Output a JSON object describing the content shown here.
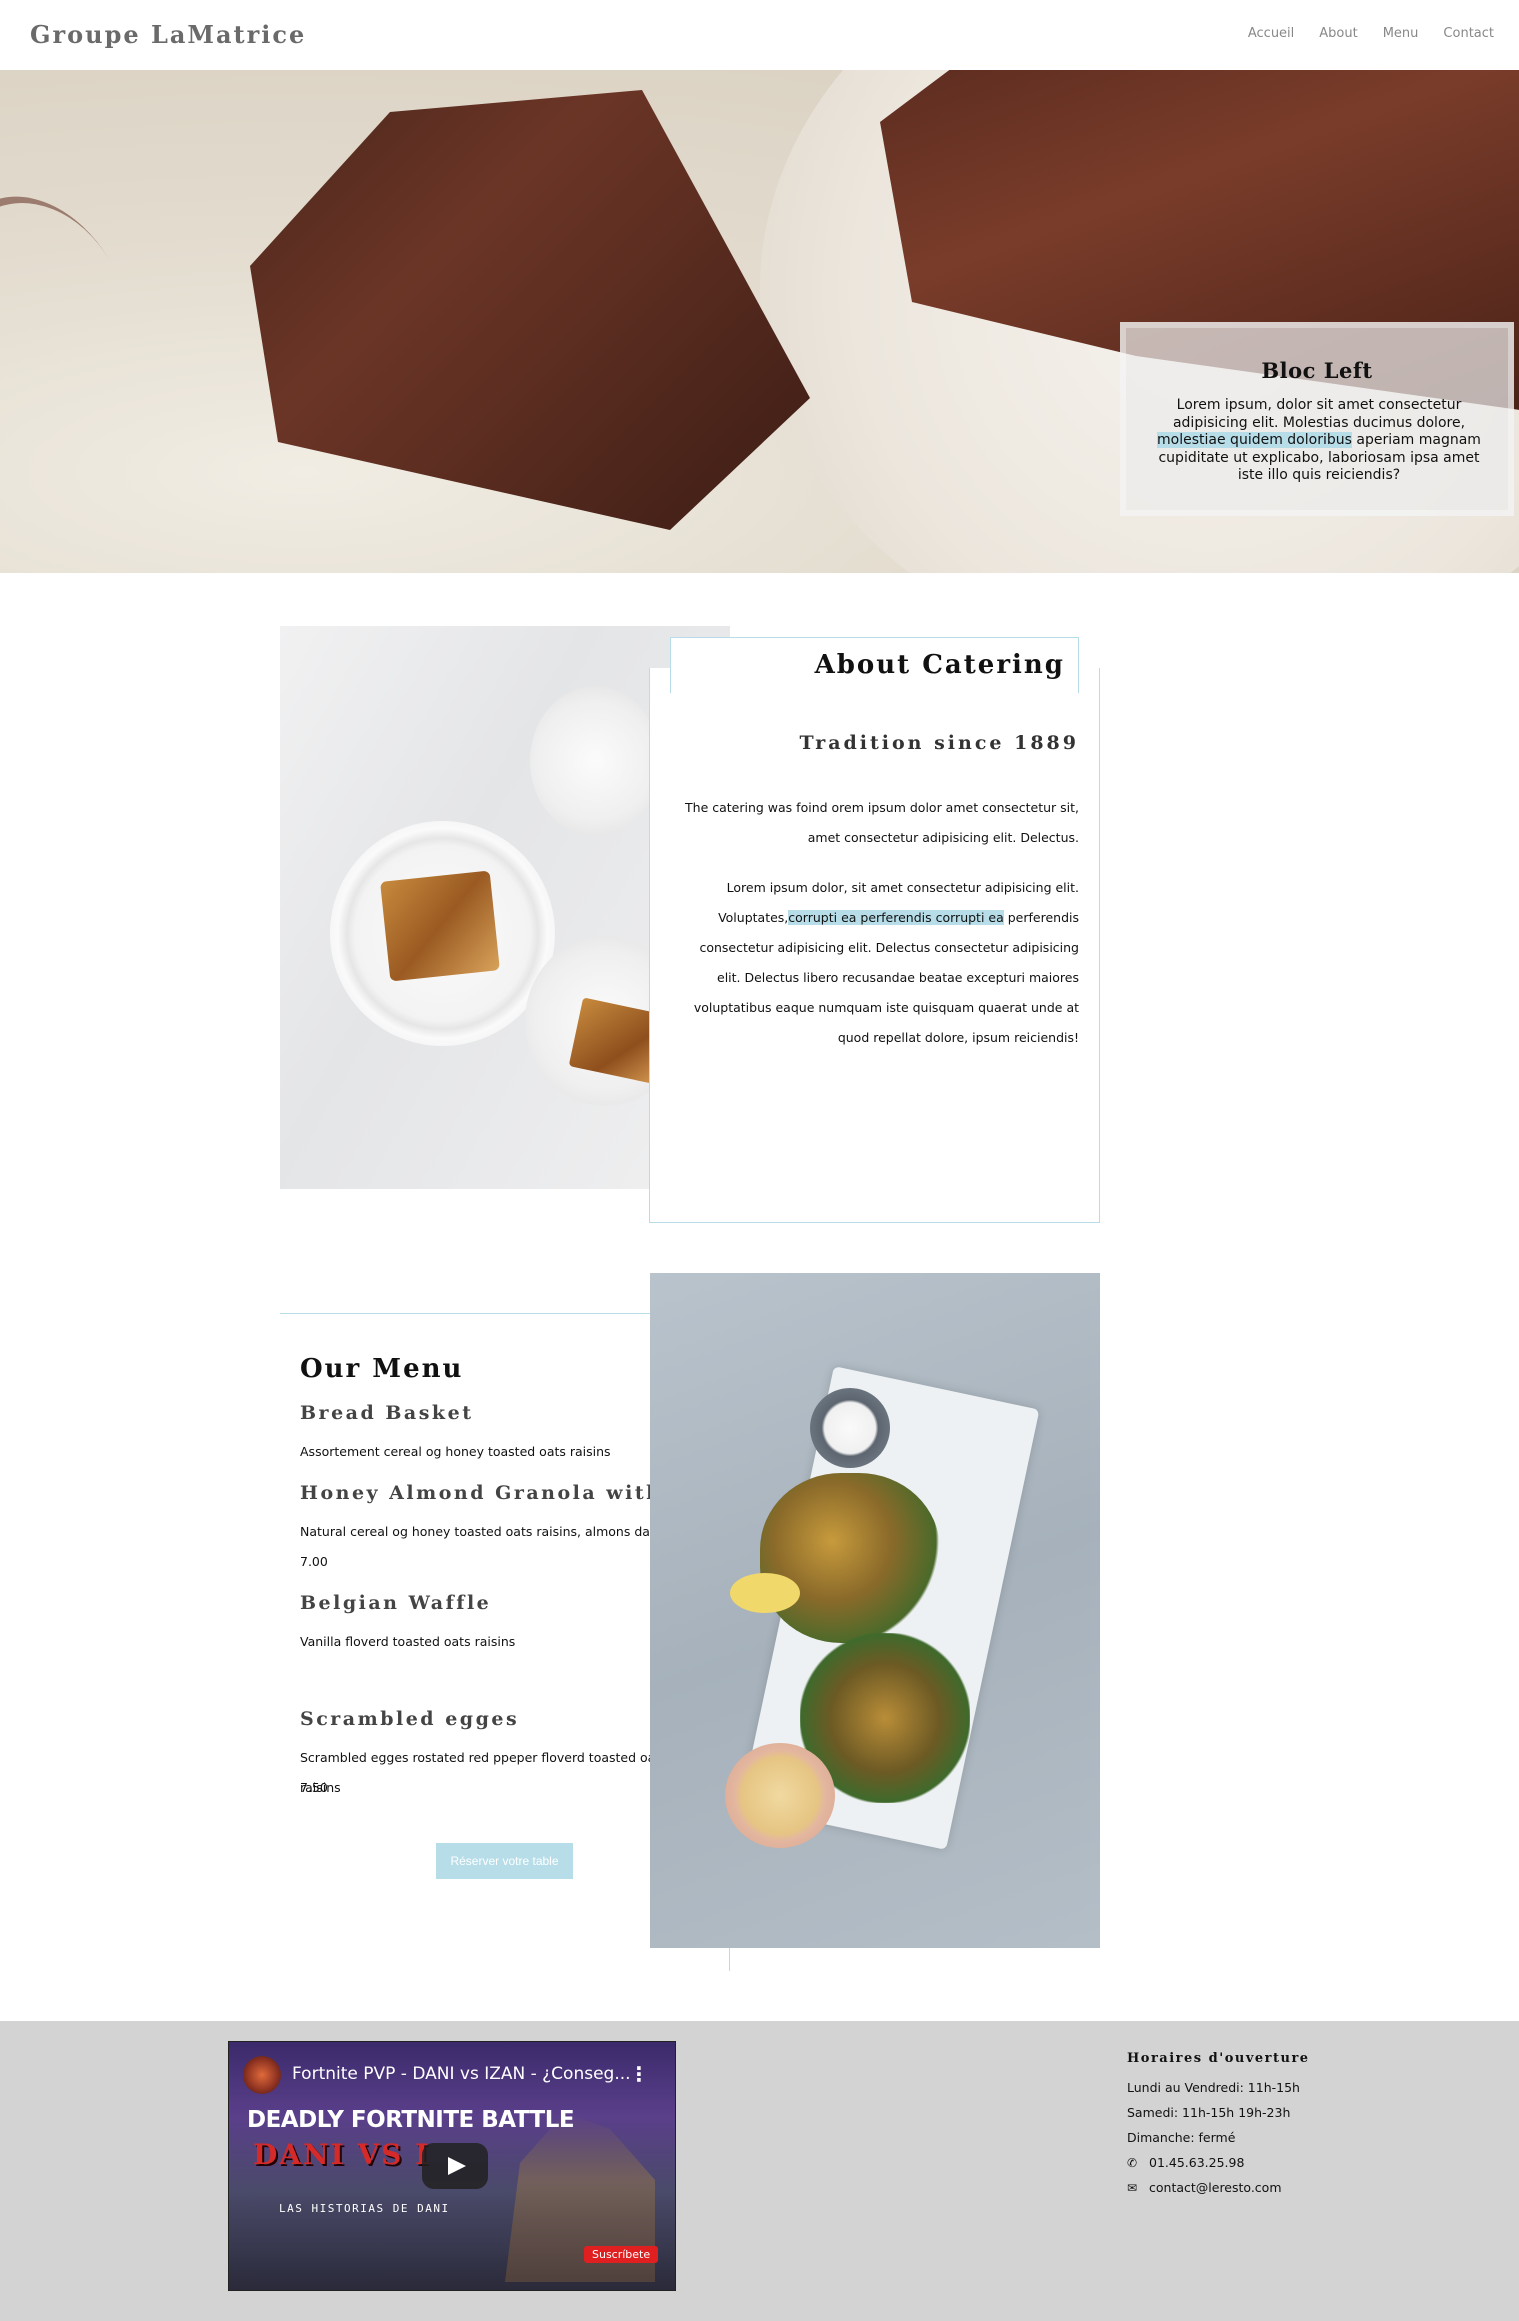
{
  "nav": {
    "brand": "Groupe LaMatrice",
    "items": [
      "Accueil",
      "About",
      "Menu",
      "Contact"
    ]
  },
  "hero": {
    "bloc_title": "Bloc Left",
    "bloc_text_before": "Lorem ipsum, dolor sit amet consectetur adipisicing elit. Molestias ducimus dolore,",
    "bloc_text_highlight": "molestiae quidem doloribus",
    "bloc_text_after": "aperiam magnam cupiditate ut explicabo, laboriosam ipsa amet iste illo quis reiciendis?"
  },
  "about": {
    "title": "About Catering",
    "subtitle": "Tradition since 1889",
    "p1": "The catering was foind orem ipsum dolor amet consectetur sit, amet consectetur adipisicing elit. Delectus.",
    "p2_before": "Lorem ipsum dolor, sit amet consectetur adipisicing elit. Voluptates,",
    "p2_highlight": "corrupti ea perferendis corrupti ea",
    "p2_after": "perferendis consectetur adipisicing elit. Delectus consectetur adipisicing elit. Delectus libero recusandae beatae excepturi maiores voluptatibus eaque numquam iste quisquam quaerat unde at quod repellat dolore, ipsum reiciendis!"
  },
  "menu": {
    "title": "Our Menu",
    "dishes": [
      {
        "name": "Bread Basket",
        "desc": "Assortement cereal og honey toasted oats raisins",
        "price": ""
      },
      {
        "name": "Honey Almond Granola with Fruits",
        "desc": "Natural cereal og honey toasted oats raisins, almons dans datezs",
        "price": "7.00"
      },
      {
        "name": "Belgian Waffle",
        "desc": "Vanilla floverd toasted oats raisins",
        "price": ""
      },
      {
        "name": "Scrambled egges",
        "desc": "Scrambled egges rostated red ppeper floverd toasted oats raisins",
        "price": "7.50"
      }
    ],
    "reserve_label": "Réserver votre table"
  },
  "footer": {
    "video": {
      "title": "Fortnite PVP - DANI vs IZAN - ¿Conseg...",
      "line1": "DEADLY FORTNITE BATTLE",
      "line2": "DANI VS I",
      "line3": "LAS HISTORIAS DE DANI",
      "subscribe": "Suscríbete"
    },
    "hours_title": "Horaires d'ouverture",
    "hours": [
      "Lundi au Vendredi: 11h-15h",
      "Samedi: 11h-15h 19h-23h",
      "Dimanche: fermé"
    ],
    "phone": "01.45.63.25.98",
    "email": "contact@leresto.com",
    "icons": {
      "phone": "phone-icon",
      "email": "envelope-icon"
    }
  }
}
